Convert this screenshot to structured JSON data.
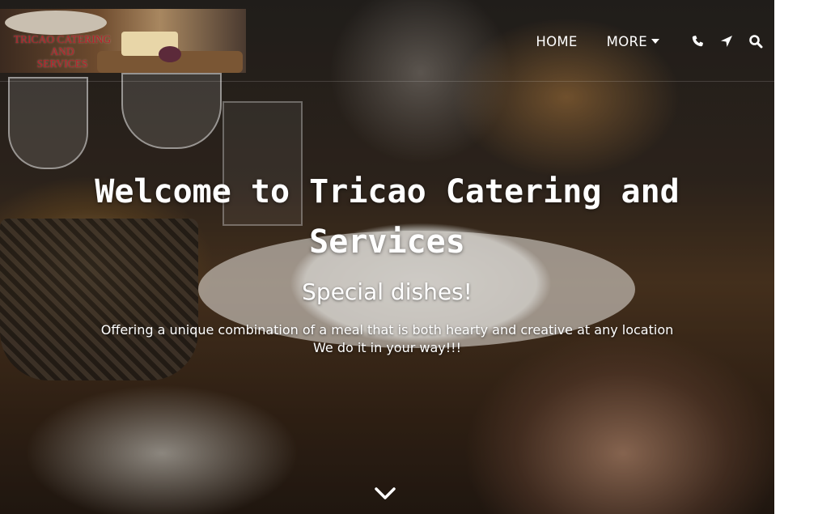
{
  "brand": {
    "logo_text_line1": "TRICAO CATERING",
    "logo_text_line2": "AND",
    "logo_text_line3": "SERVICES"
  },
  "nav": {
    "home_label": "HOME",
    "more_label": "MORE",
    "icons": [
      "phone-icon",
      "location-arrow-icon",
      "search-icon"
    ]
  },
  "hero": {
    "title": "Welcome to Tricao Catering and Services",
    "subtitle": "Special dishes!",
    "description_line1": "Offering a unique combination of a meal that is both hearty and creative at any location",
    "description_line2": "We do it in your way!!!",
    "scroll_icon": "chevron-down-icon"
  },
  "colors": {
    "nav_text": "#ffffff",
    "logo_text": "#b6212a",
    "hero_text": "#ffffff"
  }
}
